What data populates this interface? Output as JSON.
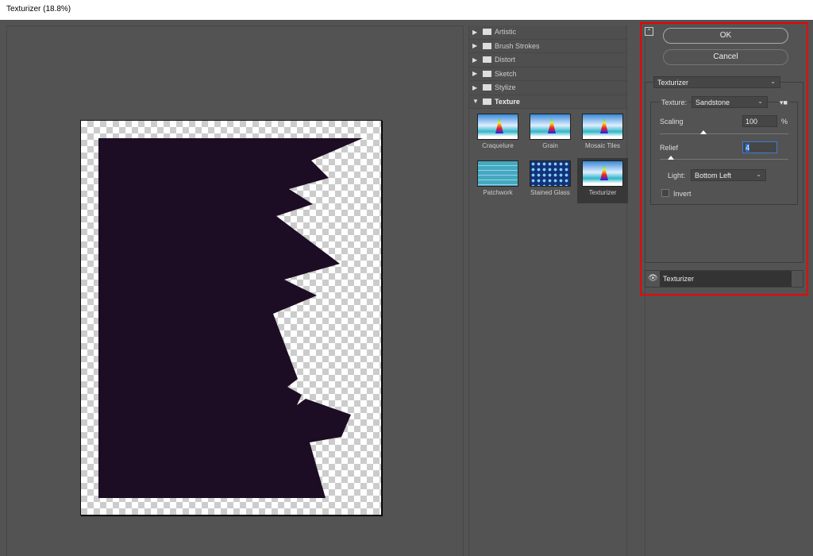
{
  "window": {
    "title": "Texturizer (18.8%)"
  },
  "gallery": {
    "categories": [
      {
        "label": "Artistic",
        "expanded": false
      },
      {
        "label": "Brush Strokes",
        "expanded": false
      },
      {
        "label": "Distort",
        "expanded": false
      },
      {
        "label": "Sketch",
        "expanded": false
      },
      {
        "label": "Stylize",
        "expanded": false
      },
      {
        "label": "Texture",
        "expanded": true
      }
    ],
    "filters": [
      "Craquelure",
      "Grain",
      "Mosaic Tiles",
      "Patchwork",
      "Stained Glass",
      "Texturizer"
    ],
    "selected": "Texturizer"
  },
  "controls": {
    "ok": "OK",
    "cancel": "Cancel",
    "filter_select": "Texturizer",
    "texture_label": "Texture:",
    "texture_value": "Sandstone",
    "scaling_label": "Scaling",
    "scaling_value": "100",
    "scaling_unit": "%",
    "relief_label": "Relief",
    "relief_value": "4",
    "light_label": "Light:",
    "light_value": "Bottom Left",
    "invert_label": "Invert",
    "invert_checked": false,
    "scaling_slider_value": 100,
    "relief_slider_value": 4
  },
  "layers": [
    {
      "label": "Texturizer",
      "visible": true
    }
  ],
  "highlight_color": "#e00000"
}
